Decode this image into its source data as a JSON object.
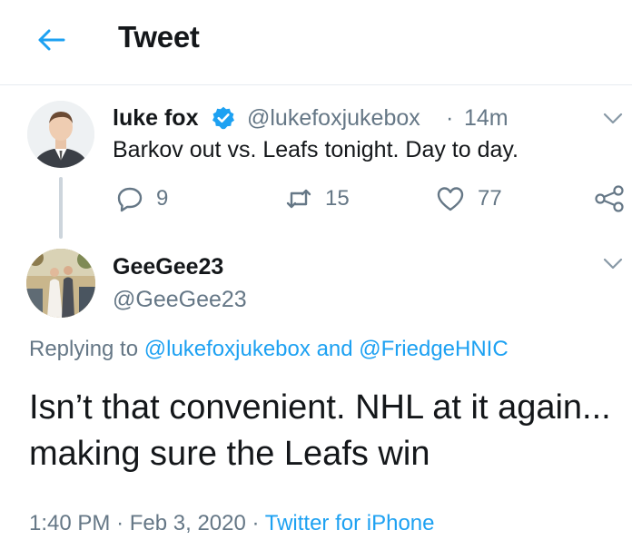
{
  "header": {
    "title": "Tweet",
    "back_icon": "arrow-left-icon"
  },
  "colors": {
    "accent": "#1da1f2",
    "secondary_text": "#657786",
    "divider": "#e6ecf0"
  },
  "parent_tweet": {
    "author_name": "luke fox",
    "verified_icon": "verified-badge-icon",
    "handle": "@lukefoxjukebox",
    "separator": "·",
    "time": "14m",
    "text": "Barkov out vs. Leafs tonight. Day to day.",
    "reply_count": "9",
    "retweet_count": "15",
    "like_count": "77"
  },
  "reply_tweet": {
    "author_name": "GeeGee23",
    "handle": "@GeeGee23",
    "replying_prefix": "Replying to",
    "replying_to_1": "@lukefoxjukebox",
    "replying_and": "and",
    "replying_to_2": "@FriedgeHNIC",
    "text": "Isn’t that convenient. NHL at it again... making sure the Leafs win",
    "time": "1:40 PM",
    "separator1": "·",
    "date": "Feb 3, 2020",
    "separator2": "·",
    "source": "Twitter for iPhone"
  }
}
